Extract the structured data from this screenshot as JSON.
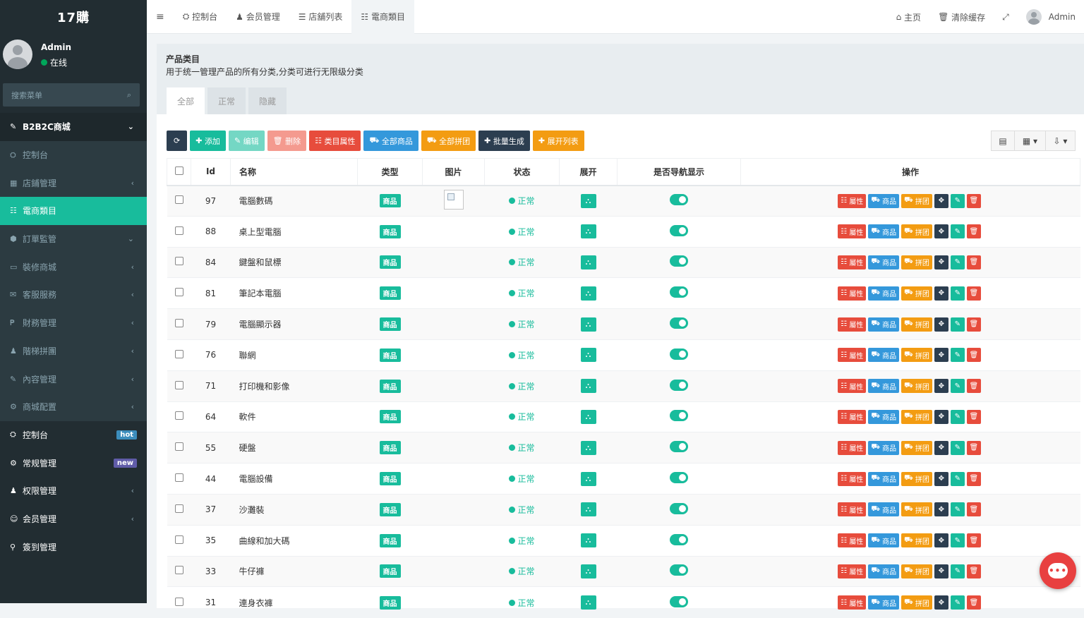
{
  "brand": "17購",
  "user": {
    "name": "Admin",
    "status": "在线"
  },
  "search": {
    "placeholder": "搜索菜单"
  },
  "sidebar": {
    "section_b2b": "B2B2C商城",
    "items": [
      {
        "label": "控制台",
        "icon": "dashboard-icon",
        "arrow": ""
      },
      {
        "label": "店鋪管理",
        "icon": "shop-icon",
        "arrow": "‹"
      },
      {
        "label": "電商類目",
        "icon": "list-icon",
        "arrow": ""
      },
      {
        "label": "訂單監管",
        "icon": "order-icon",
        "arrow": "⌄"
      },
      {
        "label": "裝修商城",
        "icon": "desktop-icon",
        "arrow": "‹"
      },
      {
        "label": "客服服務",
        "icon": "comments-icon",
        "arrow": "‹"
      },
      {
        "label": "財務管理",
        "icon": "paypal-icon",
        "arrow": "‹"
      },
      {
        "label": "階梯拼團",
        "icon": "users-icon",
        "arrow": "‹"
      },
      {
        "label": "內容管理",
        "icon": "edit-icon",
        "arrow": "‹"
      },
      {
        "label": "商城配置",
        "icon": "cog-icon",
        "arrow": "‹"
      }
    ],
    "main_items": [
      {
        "label": "控制台",
        "badge": "hot",
        "badge_color": "#3c8dbc"
      },
      {
        "label": "常规管理",
        "badge": "new",
        "badge_color": "#605ca8"
      },
      {
        "label": "权限管理",
        "arrow": "‹"
      },
      {
        "label": "会员管理",
        "arrow": "‹"
      },
      {
        "label": "簽到管理"
      }
    ]
  },
  "topnav": {
    "items": [
      "控制台",
      "会员管理",
      "店舖列表",
      "電商類目"
    ],
    "home": "主页",
    "clear_cache": "清除缓存",
    "admin": "Admin"
  },
  "panel": {
    "title": "产品类目",
    "desc": "用于统一管理产品的所有分类,分类可进行无限级分类",
    "tabs": [
      "全部",
      "正常",
      "隐藏"
    ]
  },
  "toolbar": {
    "add": "添加",
    "edit": "编辑",
    "delete": "删除",
    "attr": "类目属性",
    "all_goods": "全部商品",
    "all_group": "全部拼团",
    "batch": "批量生成",
    "expand": "展开列表"
  },
  "table": {
    "headers": [
      "Id",
      "名称",
      "类型",
      "图片",
      "状态",
      "展开",
      "是否导航显示",
      "操作"
    ],
    "type_label": "商品",
    "status_label": "正常",
    "op_labels": {
      "attr": "屬性",
      "goods": "商品",
      "group": "拼团"
    },
    "rows": [
      {
        "id": "97",
        "name": "電腦數碼"
      },
      {
        "id": "88",
        "name": "桌上型電腦"
      },
      {
        "id": "84",
        "name": "鍵盤和鼠標"
      },
      {
        "id": "81",
        "name": "筆記本電腦"
      },
      {
        "id": "79",
        "name": "電腦顯示器"
      },
      {
        "id": "76",
        "name": "聯網"
      },
      {
        "id": "71",
        "name": "打印機和影像"
      },
      {
        "id": "64",
        "name": "軟件"
      },
      {
        "id": "55",
        "name": "硬盤"
      },
      {
        "id": "44",
        "name": "電腦設備"
      },
      {
        "id": "37",
        "name": "沙灘裝"
      },
      {
        "id": "35",
        "name": "曲線和加大碼"
      },
      {
        "id": "33",
        "name": "牛仔褲"
      },
      {
        "id": "31",
        "name": "連身衣褲"
      }
    ]
  }
}
